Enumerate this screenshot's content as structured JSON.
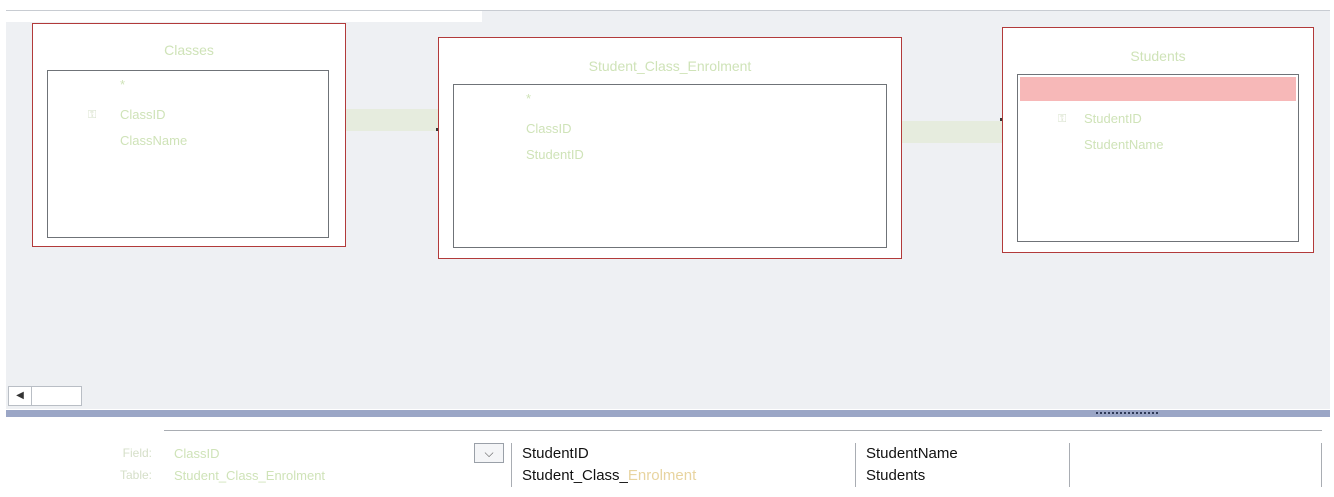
{
  "tables": [
    {
      "name": "Classes",
      "fields": [
        "*",
        "ClassID",
        "ClassName"
      ],
      "primary_key": "ClassID"
    },
    {
      "name": "Student_Class_Enrolment",
      "fields": [
        "*",
        "ClassID",
        "StudentID"
      ]
    },
    {
      "name": "Students",
      "fields": [
        "*",
        "StudentID",
        "StudentName"
      ],
      "primary_key": "StudentID",
      "selected_row": "*"
    }
  ],
  "icons": {
    "key": "key-icon",
    "scroll_left": "arrow-left-icon",
    "dropdown": "chevron-down-icon"
  },
  "scrollbar": {
    "left_arrow": "◀"
  },
  "grid": {
    "row_labels": [
      "Field:",
      "Table:"
    ],
    "columns": [
      {
        "field": "ClassID",
        "table": "Student_Class_Enrolment"
      },
      {
        "field": "StudentID",
        "table_prefix": "Student_Class_",
        "table_suffix": "Enrolment"
      },
      {
        "field": "StudentName",
        "table": "Students"
      },
      {
        "field": "",
        "table": ""
      }
    ],
    "dropdown_glyph": "⌵"
  },
  "colors": {
    "table_border": "#b23a3a",
    "selected_row": "#f7b8b8",
    "splitter": "#9ba6c6",
    "canvas": "#eef0f3"
  }
}
